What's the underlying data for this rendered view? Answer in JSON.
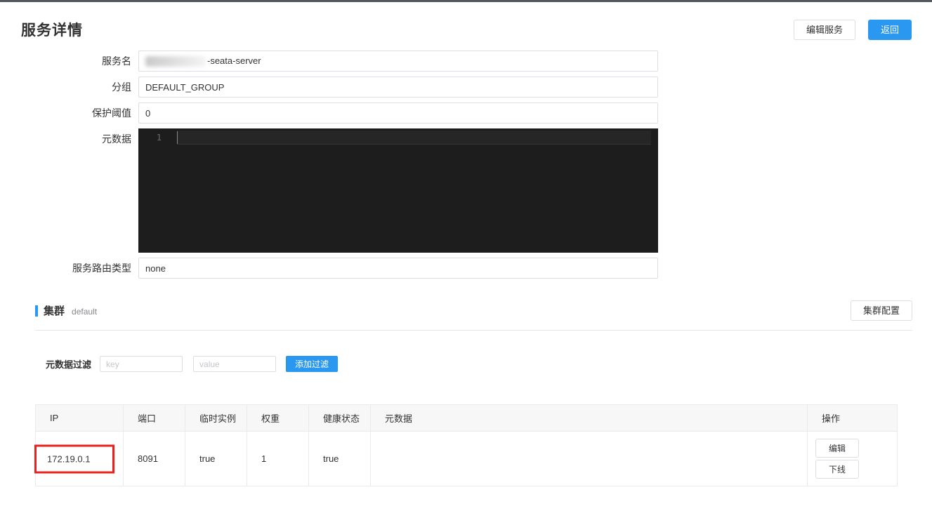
{
  "page": {
    "title": "服务详情"
  },
  "header": {
    "edit_service_button": "编辑服务",
    "back_button": "返回"
  },
  "form": {
    "service_name": {
      "label": "服务名",
      "visible_value": "-seata-server"
    },
    "group": {
      "label": "分组",
      "value": "DEFAULT_GROUP"
    },
    "protect_threshold": {
      "label": "保护阈值",
      "value": "0"
    },
    "metadata": {
      "label": "元数据",
      "line_number": "1",
      "content": ""
    },
    "route_type": {
      "label": "服务路由类型",
      "value": "none"
    }
  },
  "cluster": {
    "title": "集群",
    "name": "default",
    "config_button": "集群配置"
  },
  "filter": {
    "label": "元数据过滤",
    "key_placeholder": "key",
    "value_placeholder": "value",
    "add_button": "添加过滤"
  },
  "instances": {
    "columns": [
      "IP",
      "端口",
      "临时实例",
      "权重",
      "健康状态",
      "元数据",
      "操作"
    ],
    "rows": [
      {
        "ip": "172.19.0.1",
        "port": "8091",
        "ephemeral": "true",
        "weight": "1",
        "healthy": "true",
        "metadata": "",
        "edit_button": "编辑",
        "offline_button": "下线"
      }
    ]
  },
  "colors": {
    "primary_blue": "#2a97f1",
    "annotation_red": "#e8211d",
    "editor_background": "#1d1d1d"
  }
}
